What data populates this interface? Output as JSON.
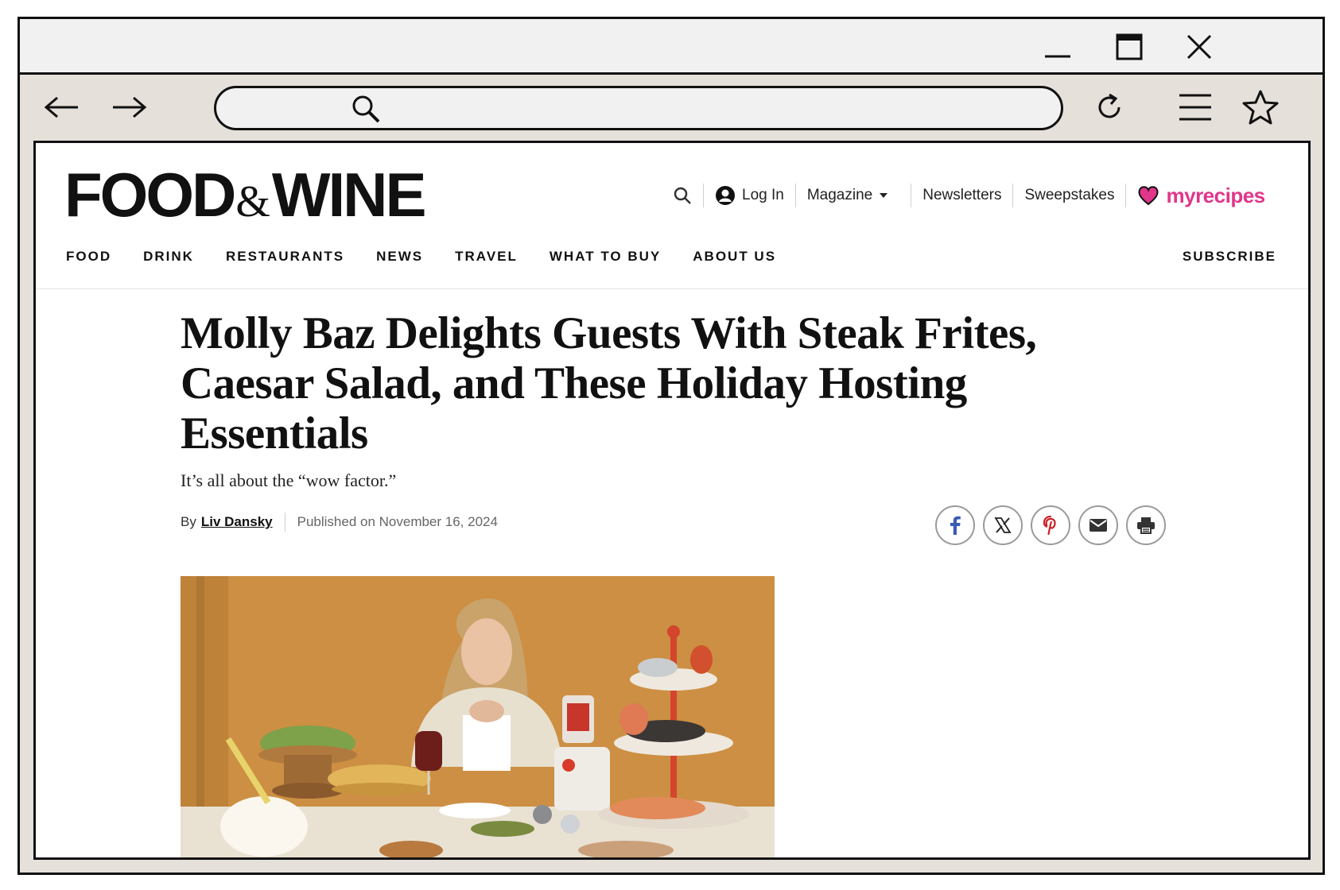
{
  "site": {
    "logo": {
      "food": "FOOD",
      "amp": "&",
      "wine": "WINE"
    },
    "utility": {
      "login": "Log In",
      "magazine": "Magazine",
      "newsletters": "Newsletters",
      "sweepstakes": "Sweepstakes",
      "myrecipes_my": "my",
      "myrecipes_recipes": "recipes"
    },
    "nav": [
      "FOOD",
      "DRINK",
      "RESTAURANTS",
      "NEWS",
      "TRAVEL",
      "WHAT TO BUY",
      "ABOUT US"
    ],
    "subscribe": "SUBSCRIBE"
  },
  "article": {
    "headline": "Molly Baz Delights Guests With Steak Frites, Caesar Salad, and These Holiday Hosting Essentials",
    "dek": "It’s all about the “wow factor.”",
    "by": "By",
    "author": "Liv Dansky",
    "published": "Published on November 16, 2024",
    "share": [
      "facebook-icon",
      "x-icon",
      "pinterest-icon",
      "email-icon",
      "print-icon"
    ]
  },
  "colors": {
    "brand_pink": "#e0368a",
    "hero_bg": "#c98b3e",
    "chrome_bg": "#e6e0da"
  }
}
